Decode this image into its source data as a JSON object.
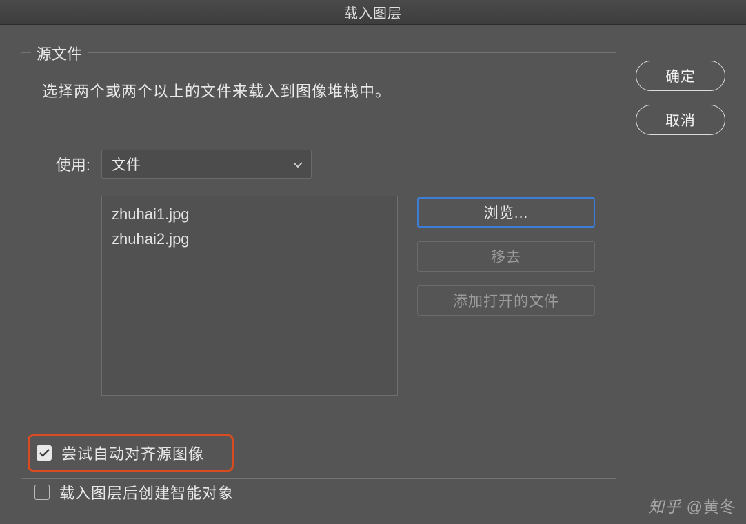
{
  "titlebar": {
    "title": "载入图层"
  },
  "fieldset": {
    "legend": "源文件",
    "instruction": "选择两个或两个以上的文件来载入到图像堆栈中。",
    "use_label": "使用:",
    "use_select": "文件",
    "files": [
      "zhuhai1.jpg",
      "zhuhai2.jpg"
    ],
    "browse_btn": "浏览...",
    "remove_btn": "移去",
    "add_open_btn": "添加打开的文件"
  },
  "checks": {
    "auto_align": {
      "label": "尝试自动对齐源图像",
      "checked": true
    },
    "smart_object": {
      "label": "载入图层后创建智能对象",
      "checked": false
    }
  },
  "side": {
    "ok_btn": "确定",
    "cancel_btn": "取消"
  },
  "watermark": {
    "prefix": "知乎 ",
    "at": "@黄冬"
  }
}
